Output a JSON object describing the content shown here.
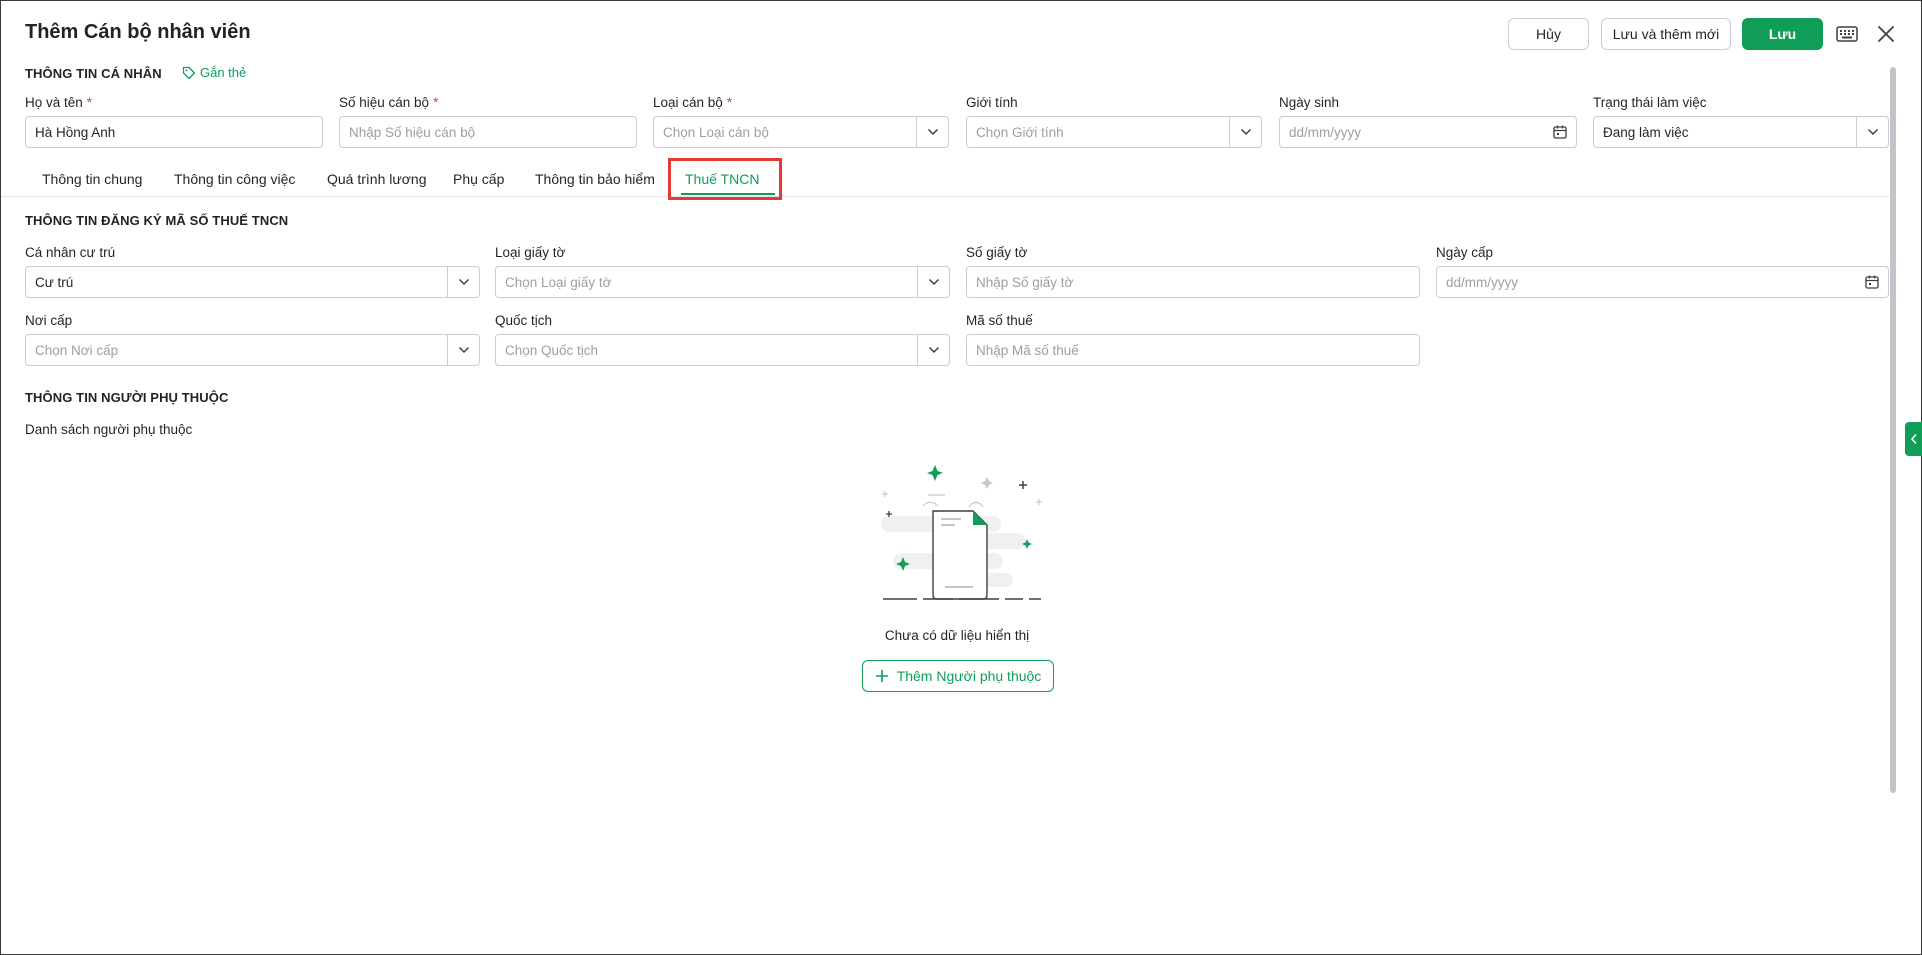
{
  "header": {
    "title": "Thêm Cán bộ nhân viên",
    "cancel_label": "Hủy",
    "save_new_label": "Lưu và thêm mới",
    "save_label": "Lưu"
  },
  "personal": {
    "section_title": "THÔNG TIN CÁ NHÂN",
    "tag_label": "Gắn thẻ",
    "fields": {
      "name": {
        "label": "Họ và tên",
        "required": "*",
        "value": "Hà Hồng Anh"
      },
      "code": {
        "label": "Số hiệu cán bộ",
        "required": "*",
        "placeholder": "Nhập Số hiệu cán bộ"
      },
      "type": {
        "label": "Loại cán bộ",
        "required": "*",
        "placeholder": "Chọn Loại cán bộ"
      },
      "gender": {
        "label": "Giới tính",
        "placeholder": "Chọn Giới tính"
      },
      "birth": {
        "label": "Ngày sinh",
        "placeholder": "dd/mm/yyyy"
      },
      "status": {
        "label": "Trạng thái làm việc",
        "value": "Đang làm việc"
      }
    }
  },
  "tabs": [
    {
      "label": "Thông tin chung"
    },
    {
      "label": "Thông tin công việc"
    },
    {
      "label": "Quá trình lương"
    },
    {
      "label": "Phụ cấp"
    },
    {
      "label": "Thông tin bảo hiểm"
    },
    {
      "label": "Thuế TNCN",
      "active": true
    }
  ],
  "tax": {
    "section_title": "THÔNG TIN ĐĂNG KÝ MÃ SỐ THUẾ TNCN",
    "residency": {
      "label": "Cá nhân cư trú",
      "value": "Cư trú"
    },
    "doc_type": {
      "label": "Loại giấy tờ",
      "placeholder": "Chọn Loại giấy tờ"
    },
    "doc_no": {
      "label": "Số giấy tờ",
      "placeholder": "Nhập Số giấy tờ"
    },
    "issue_date": {
      "label": "Ngày cấp",
      "placeholder": "dd/mm/yyyy"
    },
    "issue_place": {
      "label": "Nơi cấp",
      "placeholder": "Chọn Nơi cấp"
    },
    "nationality": {
      "label": "Quốc tịch",
      "placeholder": "Chọn Quốc tịch"
    },
    "tax_code": {
      "label": "Mã số thuế",
      "placeholder": "Nhập Mã số thuế"
    }
  },
  "dependents": {
    "section_title": "THÔNG TIN NGƯỜI PHỤ THUỘC",
    "list_label": "Danh sách người phụ thuộc",
    "empty_text": "Chưa có dữ liệu hiển thị",
    "add_label": "Thêm Người phụ thuộc"
  },
  "colors": {
    "accent": "#0f9d58",
    "highlight": "#e53935",
    "border": "#c9ccd1",
    "placeholder": "#9aa0a6"
  },
  "icons": [
    "tag-icon",
    "chevron-down-icon",
    "calendar-icon",
    "keyboard-icon",
    "close-icon",
    "plus-icon",
    "chevron-left-icon",
    "empty-document-illustration"
  ]
}
